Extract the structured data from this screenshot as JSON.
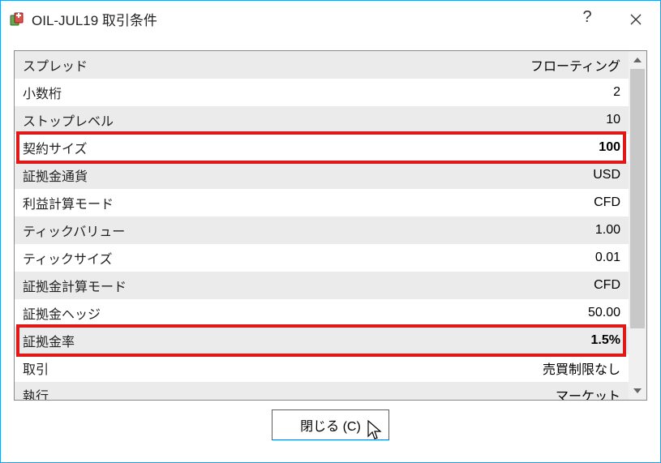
{
  "window": {
    "title": "OIL-JUL19 取引条件"
  },
  "rows": {
    "r0": {
      "label": "スプレッド",
      "value": "フローティング"
    },
    "r1": {
      "label": "小数桁",
      "value": "2"
    },
    "r2": {
      "label": "ストップレベル",
      "value": "10"
    },
    "r3": {
      "label": "契約サイズ",
      "value": "100"
    },
    "r4": {
      "label": "証拠金通貨",
      "value": "USD"
    },
    "r5": {
      "label": "利益計算モード",
      "value": "CFD"
    },
    "r6": {
      "label": "ティックバリュー",
      "value": "1.00"
    },
    "r7": {
      "label": "ティックサイズ",
      "value": "0.01"
    },
    "r8": {
      "label": "証拠金計算モード",
      "value": "CFD"
    },
    "r9": {
      "label": "証拠金ヘッジ",
      "value": "50.00"
    },
    "r10": {
      "label": "証拠金率",
      "value": "1.5%"
    },
    "r11": {
      "label": "取引",
      "value": "売買制限なし"
    },
    "r12": {
      "label": "執行",
      "value": "マーケット"
    }
  },
  "highlights": {
    "contract_size_row_index": 3,
    "margin_rate_row_index": 10
  },
  "footer": {
    "close_label": "閉じる (C)"
  }
}
